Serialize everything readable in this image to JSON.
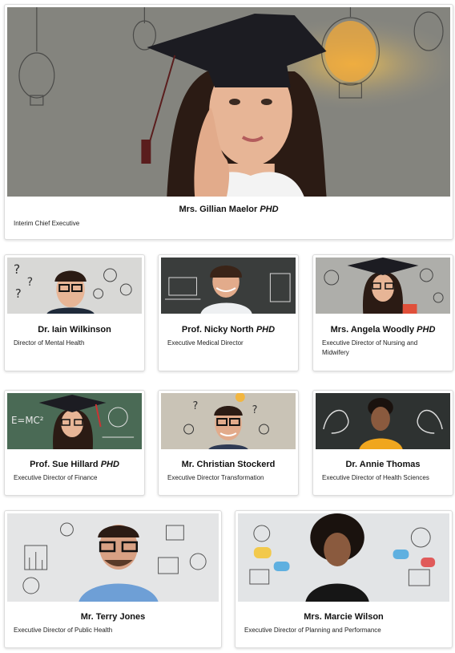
{
  "people": [
    {
      "name": "Mrs. Gillian Maelor",
      "suffix": "PHD",
      "role": "Interim Chief Executive"
    },
    {
      "name": "Dr. Iain Wilkinson",
      "suffix": "",
      "role": "Director of Mental Health"
    },
    {
      "name": "Prof. Nicky North",
      "suffix": "PHD",
      "role": "Executive Medical Director"
    },
    {
      "name": "Mrs. Angela Woodly",
      "suffix": "PHD",
      "role": "Executive Director of Nursing and Midwifery"
    },
    {
      "name": "Prof. Sue Hillard",
      "suffix": "PHD",
      "role": "Executive Director of Finance"
    },
    {
      "name": "Mr. Christian Stockerd",
      "suffix": "",
      "role": "Executive Director Transformation"
    },
    {
      "name": "Dr. Annie Thomas",
      "suffix": "",
      "role": "Executive Director of Health Sciences"
    },
    {
      "name": "Mr. Terry Jones",
      "suffix": "",
      "role": "Executive Director of Public Health"
    },
    {
      "name": "Mrs. Marcie Wilson",
      "suffix": "",
      "role": "Executive Director of Planning and Performance"
    }
  ],
  "colors": {
    "card_border": "#dcdcdc",
    "photo_grey": "#8c8c86",
    "chalkboard": "#3a3d3c",
    "bulb_glow": "#f2b640",
    "skin": "#e7b596",
    "hair_dark": "#2b1b14",
    "cap": "#1c1c22"
  }
}
